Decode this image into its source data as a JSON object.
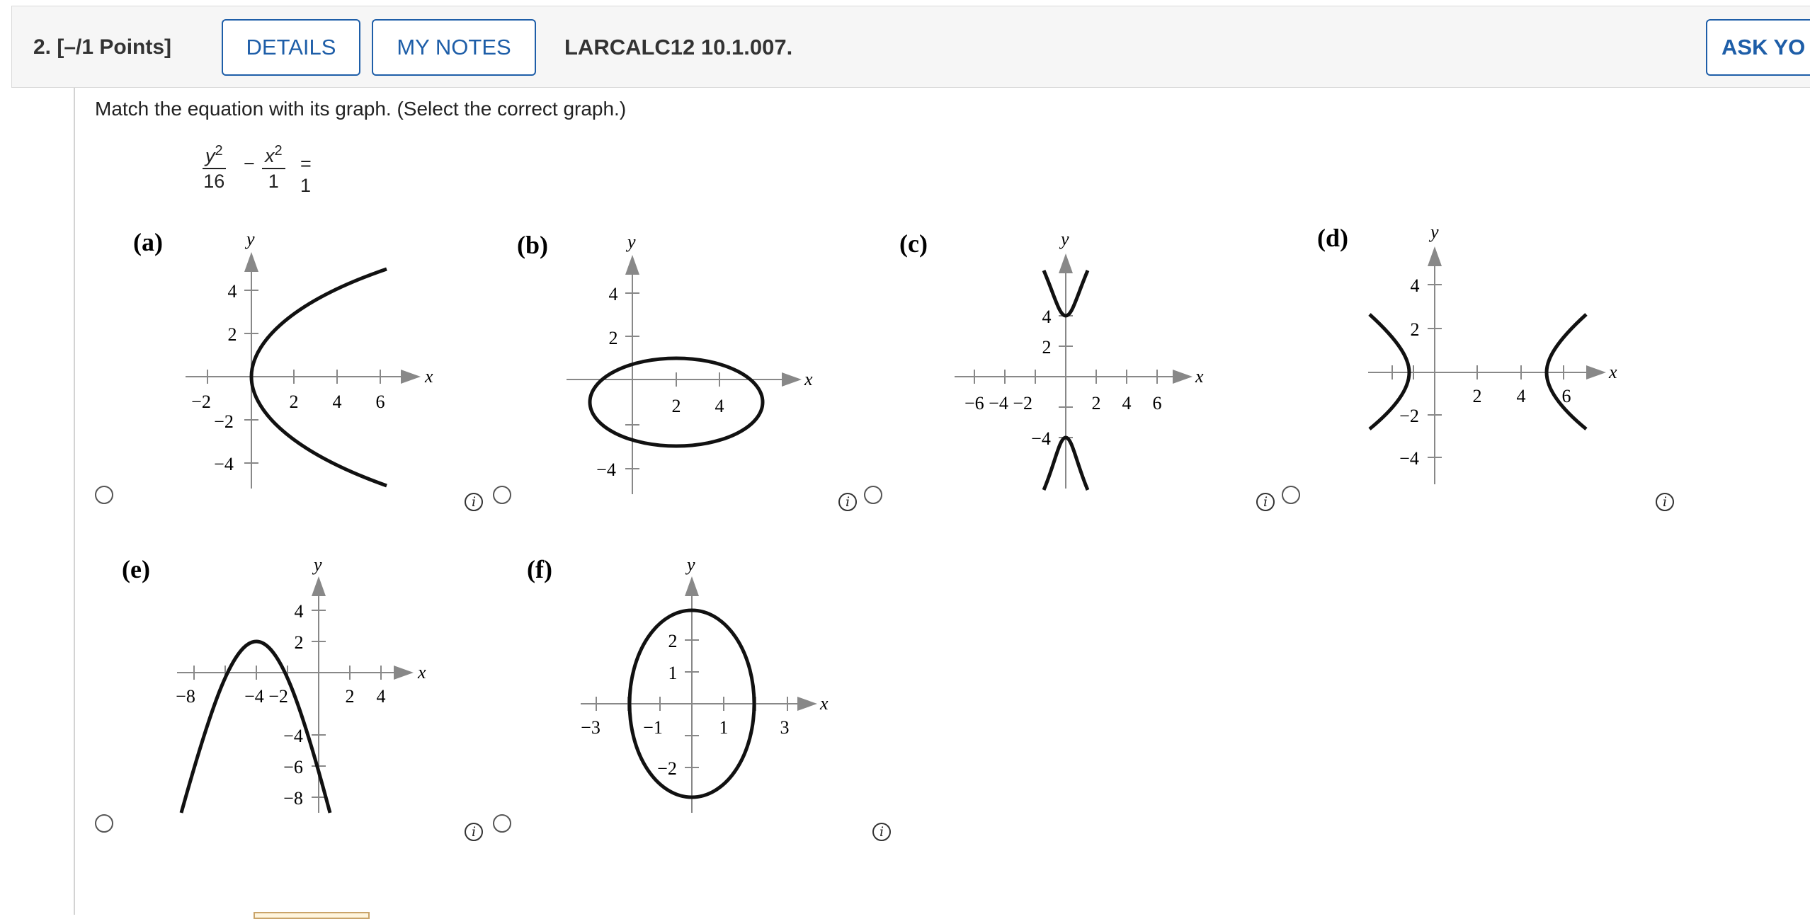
{
  "header": {
    "question_label": "2.  [–/1 Points]",
    "details_button": "DETAILS",
    "notes_button": "MY NOTES",
    "problem_code": "LARCALC12 10.1.007.",
    "ask_button": "ASK YO"
  },
  "question": {
    "prompt": "Match the equation with its graph. (Select the correct graph.)",
    "equation": {
      "term1_num": "y",
      "term1_exp": "2",
      "term1_den": "16",
      "minus": "−",
      "term2_num": "x",
      "term2_exp": "2",
      "term2_den": "1",
      "rhs": "= 1"
    }
  },
  "options": [
    {
      "label": "(a)",
      "x_ticks": [
        "−2",
        "2",
        "4",
        "6"
      ],
      "y_ticks": [
        "4",
        "2",
        "−2",
        "−4"
      ]
    },
    {
      "label": "(b)",
      "x_ticks": [
        "2",
        "4"
      ],
      "y_ticks": [
        "4",
        "2",
        "−4"
      ]
    },
    {
      "label": "(c)",
      "x_ticks": [
        "−6 −4 −2",
        "2",
        "4",
        "6"
      ],
      "y_ticks": [
        "4",
        "2",
        "−4"
      ]
    },
    {
      "label": "(d)",
      "x_ticks": [
        "2",
        "4",
        "6"
      ],
      "y_ticks": [
        "4",
        "2",
        "−2",
        "−4"
      ]
    },
    {
      "label": "(e)",
      "x_ticks": [
        "−8",
        "−4 −2",
        "2",
        "4"
      ],
      "y_ticks": [
        "4",
        "2",
        "−4",
        "−6",
        "−8"
      ]
    },
    {
      "label": "(f)",
      "x_ticks": [
        "−3",
        "−1",
        "1",
        "3"
      ],
      "y_ticks": [
        "2",
        "1",
        "−2"
      ]
    }
  ],
  "axis_names": {
    "x": "x",
    "y": "y"
  },
  "info_glyph": "i",
  "icons": {
    "radio": "radio-button",
    "info": "info-icon",
    "arrow": "arrow-icon"
  }
}
